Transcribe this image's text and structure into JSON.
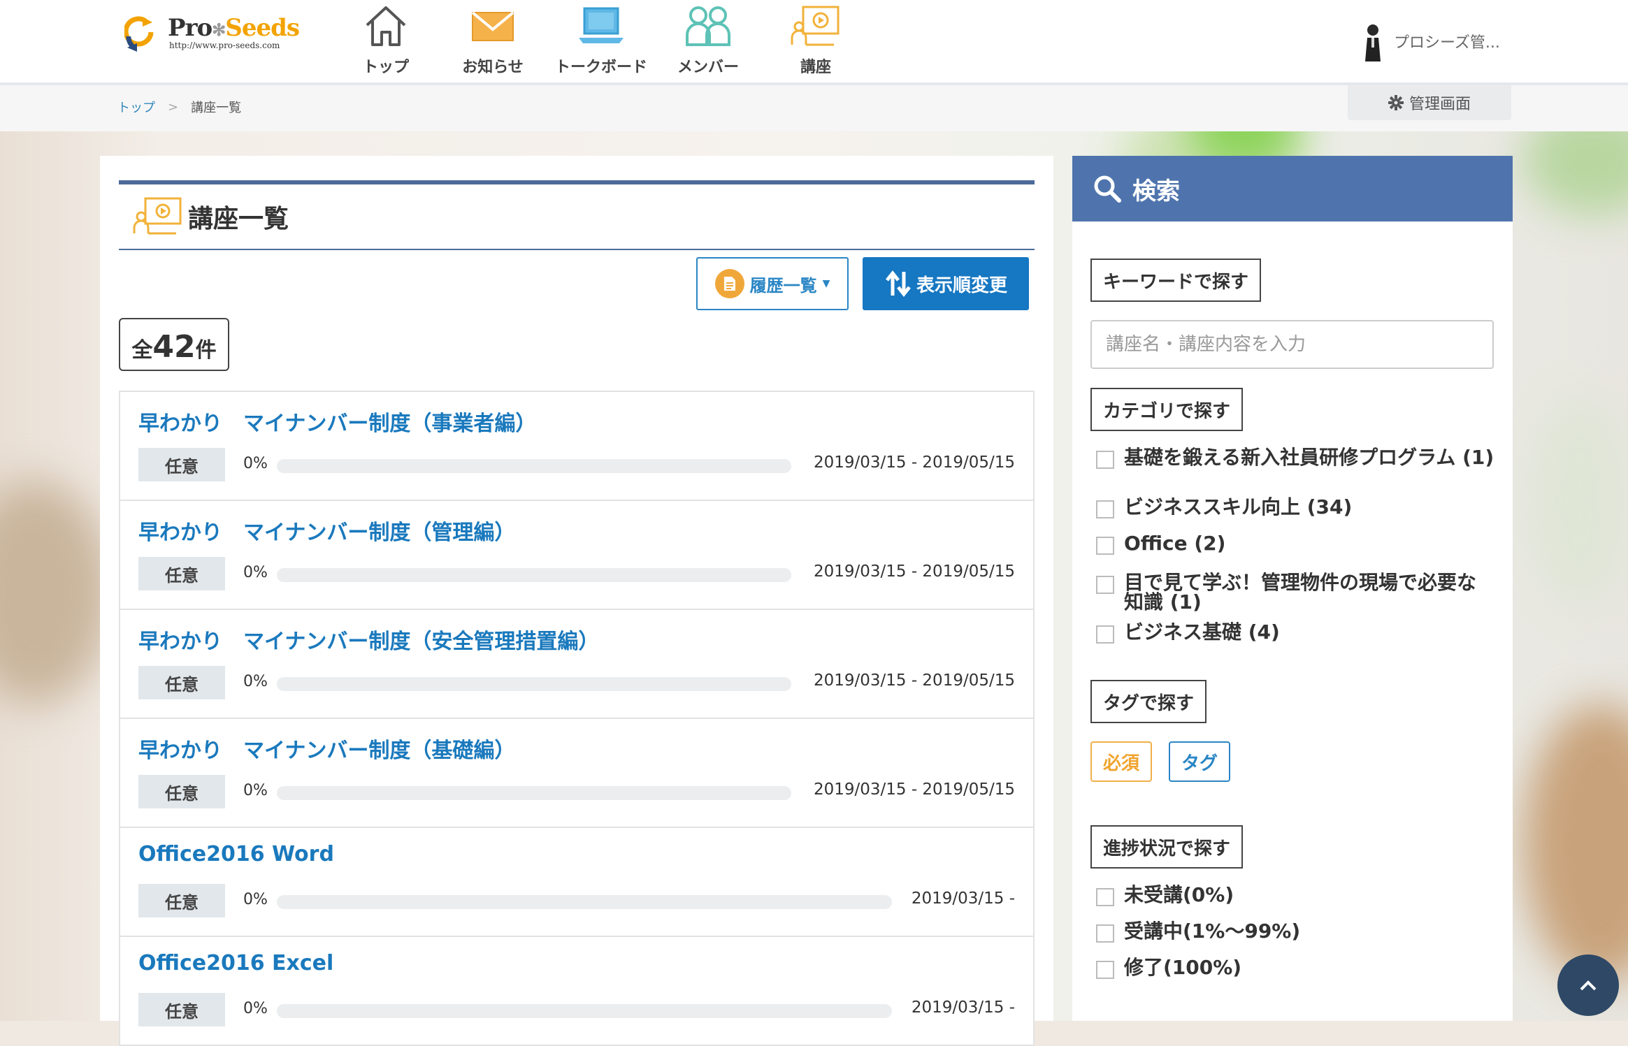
{
  "header": {
    "logo": {
      "brand_pro": "Pro",
      "brand_seeds": "Seeds",
      "url": "http://www.pro-seeds.com"
    },
    "nav": [
      {
        "label": "トップ",
        "icon": "home-icon"
      },
      {
        "label": "お知らせ",
        "icon": "mail-icon"
      },
      {
        "label": "トークボード",
        "icon": "laptop-icon"
      },
      {
        "label": "メンバー",
        "icon": "members-icon"
      },
      {
        "label": "講座",
        "icon": "course-icon"
      }
    ],
    "user_name": "プロシーズ管..."
  },
  "breadcrumb": {
    "home": "トップ",
    "sep": ">",
    "current": "講座一覧"
  },
  "admin_button": "管理画面",
  "main": {
    "title": "講座一覧",
    "history_button": "履歴一覧",
    "sort_button": "表示順変更",
    "count_prefix": "全",
    "count_value": "42",
    "count_suffix": "件",
    "courses": [
      {
        "title": "早わかり　マイナンバー制度（事業者編）",
        "badge": "任意",
        "percent_label": "0%",
        "progress": 0,
        "date": "2019/03/15 - 2019/05/15"
      },
      {
        "title": "早わかり　マイナンバー制度（管理編）",
        "badge": "任意",
        "percent_label": "0%",
        "progress": 0,
        "date": "2019/03/15 - 2019/05/15"
      },
      {
        "title": "早わかり　マイナンバー制度（安全管理措置編）",
        "badge": "任意",
        "percent_label": "0%",
        "progress": 0,
        "date": "2019/03/15 - 2019/05/15"
      },
      {
        "title": "早わかり　マイナンバー制度（基礎編）",
        "badge": "任意",
        "percent_label": "0%",
        "progress": 0,
        "date": "2019/03/15 - 2019/05/15"
      },
      {
        "title": "Office2016 Word",
        "badge": "任意",
        "percent_label": "0%",
        "progress": 0,
        "date": "2019/03/15 -"
      },
      {
        "title": "Office2016 Excel",
        "badge": "任意",
        "percent_label": "0%",
        "progress": 0,
        "date": "2019/03/15 -"
      }
    ]
  },
  "search": {
    "title": "検索",
    "keyword_label": "キーワードで探す",
    "keyword_placeholder": "講座名・講座内容を入力",
    "category_label": "カテゴリで探す",
    "categories": [
      "基礎を鍛える新入社員研修プログラム (1)",
      "ビジネススキル向上 (34)",
      "Office (2)",
      "目で見て学ぶ！管理物件の現場で必要な知識 (1)",
      "ビジネス基礎 (4)"
    ],
    "tag_label": "タグで探す",
    "tags": [
      "必須",
      "タグ"
    ],
    "progress_label": "進捗状況で探す",
    "progress_options": [
      "未受講(0%)",
      "受講中(1%〜99%)",
      "修了(100%)"
    ]
  },
  "colors": {
    "accent": "#1a79bd",
    "header_blue": "#4f74ad",
    "orange": "#f0a42e"
  }
}
